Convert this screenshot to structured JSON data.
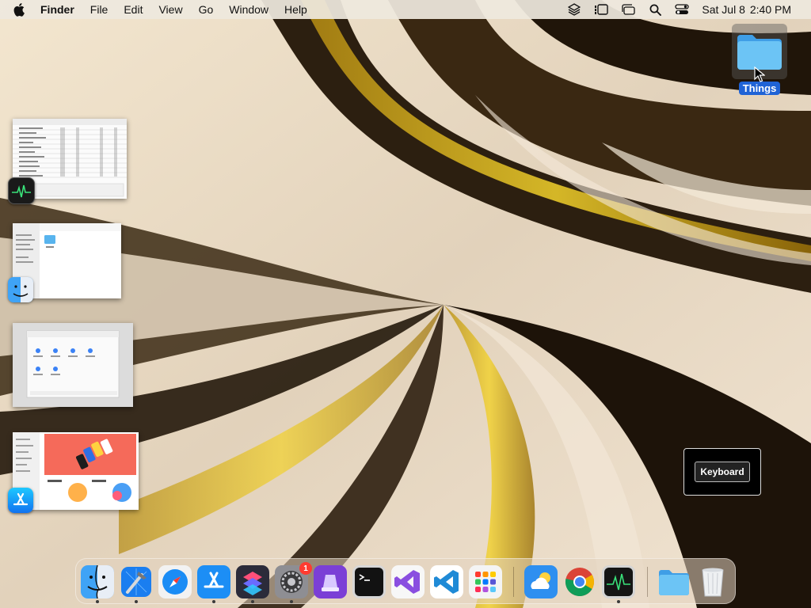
{
  "menubar": {
    "app_name": "Finder",
    "items": [
      "File",
      "Edit",
      "View",
      "Go",
      "Window",
      "Help"
    ],
    "clock": {
      "date": "Sat Jul 8",
      "time": "2:40 PM"
    },
    "status_icons": [
      "layers-icon",
      "stage-manager-icon",
      "window-stack-icon",
      "spotlight-search-icon",
      "control-center-icon"
    ]
  },
  "desktop": {
    "folder": {
      "label": "Things",
      "icon": "folder-icon",
      "selected": true
    }
  },
  "stage_manager": {
    "groups": [
      {
        "app": "Activity Monitor",
        "icon": "activity-monitor-icon"
      },
      {
        "app": "Finder",
        "icon": "finder-icon"
      },
      {
        "app": "Settings Window",
        "icon": "settings-window-thumbnail"
      },
      {
        "app": "App Store",
        "icon": "app-store-icon"
      }
    ]
  },
  "overlay": {
    "label": "Keyboard"
  },
  "dock": {
    "items": [
      {
        "name": "Finder",
        "icon": "finder-icon",
        "running": true
      },
      {
        "name": "Xcode",
        "icon": "xcode-icon",
        "running": true
      },
      {
        "name": "Safari",
        "icon": "safari-icon",
        "running": false
      },
      {
        "name": "App Store",
        "icon": "app-store-icon",
        "running": true
      },
      {
        "name": "Shortcuts",
        "icon": "shortcuts-icon",
        "running": true
      },
      {
        "name": "System Settings",
        "icon": "system-settings-icon",
        "running": true,
        "badge": "1"
      },
      {
        "name": "Archive Utility",
        "icon": "archive-icon",
        "running": false
      },
      {
        "name": "Terminal",
        "icon": "terminal-icon",
        "running": false
      },
      {
        "name": "Visual Studio",
        "icon": "visual-studio-icon",
        "running": false
      },
      {
        "name": "Visual Studio Code",
        "icon": "vscode-icon",
        "running": false
      },
      {
        "name": "Launchpad",
        "icon": "launchpad-icon",
        "running": false
      },
      {
        "name": "Weather",
        "icon": "weather-icon",
        "running": false
      },
      {
        "name": "Google Chrome",
        "icon": "chrome-icon",
        "running": false
      },
      {
        "name": "Activity Monitor",
        "icon": "activity-monitor-icon",
        "running": true
      },
      {
        "name": "Folder",
        "icon": "folder-icon",
        "running": false
      },
      {
        "name": "Trash",
        "icon": "trash-icon",
        "running": false
      }
    ]
  },
  "colors": {
    "accent": "#1f63d6",
    "badge": "#ff3b30",
    "folder": "#5bb7f0"
  }
}
